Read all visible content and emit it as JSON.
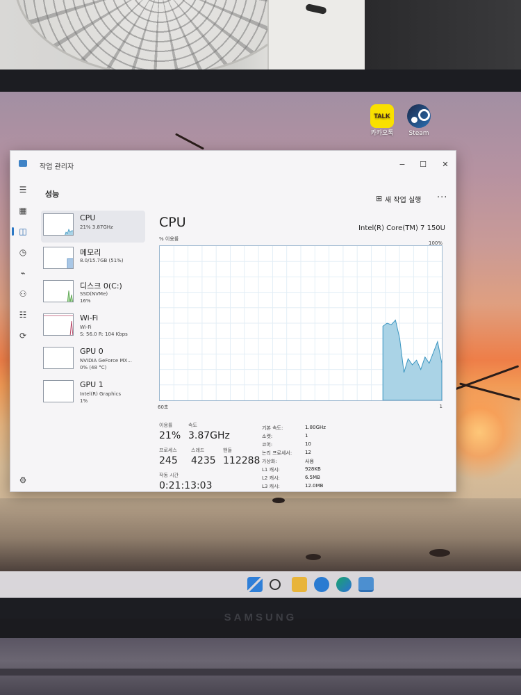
{
  "desktop": {
    "icons": [
      {
        "label": "카카오톡",
        "logo_text": "TALK",
        "icon": "kakaotalk-icon"
      },
      {
        "label": "Steam",
        "icon": "steam-icon"
      }
    ]
  },
  "device": {
    "brand": "SAMSUNG"
  },
  "window": {
    "title": "작업 관리자",
    "controls": {
      "minimize": "−",
      "maximize": "☐",
      "close": "✕"
    }
  },
  "nav": {
    "icons": [
      "hamburger-icon",
      "processes-icon",
      "performance-icon",
      "app-history-icon",
      "startup-icon",
      "users-icon",
      "details-icon",
      "services-icon",
      "settings-icon"
    ],
    "active": "performance-icon"
  },
  "header": {
    "title": "성능",
    "new_task": "새 작업 실행",
    "more": "···"
  },
  "resources": [
    {
      "name": "CPU",
      "sub1": "21% 3.87GHz",
      "sub2": "",
      "color": "#4a90c8"
    },
    {
      "name": "메모리",
      "sub1": "8.0/15.7GB (51%)",
      "sub2": "",
      "color": "#7aaad6"
    },
    {
      "name": "디스크 0(C:)",
      "sub1": "SSD(NVMe)",
      "sub2": "16%",
      "color": "#56a04a"
    },
    {
      "name": "Wi-Fi",
      "sub1": "Wi-Fi",
      "sub2": "S: 56.0  R: 104 Kbps",
      "color": "#b84a6a"
    },
    {
      "name": "GPU 0",
      "sub1": "NVIDIA GeForce MX...",
      "sub2": "0% (48 °C)",
      "color": "#6a7a8a"
    },
    {
      "name": "GPU 1",
      "sub1": "Intel(R) Graphics",
      "sub2": "1%",
      "color": "#6a7a8a"
    }
  ],
  "cpu": {
    "title": "CPU",
    "model": "Intel(R) Core(TM) 7 150U",
    "util_label": "% 이용률",
    "util_max": "100%",
    "axis_left": "60초",
    "axis_right": "1",
    "graph_fill": "#aad3e6",
    "graph_line": "#3a95c0",
    "utilization_history": [
      0,
      0,
      0,
      0,
      0,
      0,
      0,
      0,
      0,
      0,
      0,
      0,
      0,
      0,
      0,
      0,
      0,
      0,
      0,
      0,
      0,
      0,
      0,
      0,
      0,
      0,
      0,
      0,
      0,
      0,
      0,
      0,
      0,
      0,
      0,
      0,
      0,
      0,
      0,
      0,
      0,
      0,
      0,
      0,
      0,
      0,
      0,
      0,
      0,
      0,
      0,
      0,
      0,
      48,
      50,
      49,
      52,
      40,
      18,
      27,
      23,
      26,
      20,
      28,
      24,
      31,
      38,
      24
    ],
    "stats": {
      "utilization": {
        "label": "이용률",
        "value": "21%"
      },
      "speed": {
        "label": "속도",
        "value": "3.87GHz"
      },
      "processes": {
        "label": "프로세스",
        "value": "245"
      },
      "threads": {
        "label": "스레드",
        "value": "4235"
      },
      "handles": {
        "label": "핸들",
        "value": "112288"
      },
      "uptime": {
        "label": "작동 시간",
        "value": "0:21:13:03"
      }
    },
    "details": [
      {
        "k": "기본 속도:",
        "v": "1.80GHz"
      },
      {
        "k": "소켓:",
        "v": "1"
      },
      {
        "k": "코어:",
        "v": "10"
      },
      {
        "k": "논리 프로세서:",
        "v": "12"
      },
      {
        "k": "가상화:",
        "v": "사용"
      },
      {
        "k": "L1 캐시:",
        "v": "928KB"
      },
      {
        "k": "L2 캐시:",
        "v": "6.5MB"
      },
      {
        "k": "L3 캐시:",
        "v": "12.0MB"
      }
    ]
  }
}
